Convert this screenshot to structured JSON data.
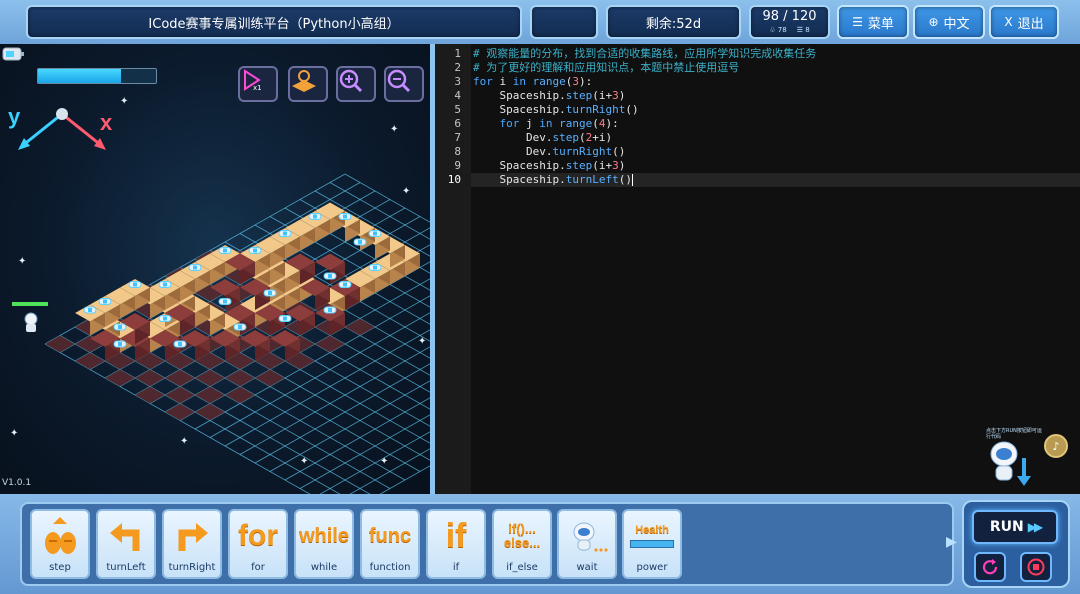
{
  "header": {
    "title": "ICode赛事专属训练平台（Python小高组）",
    "blank": "",
    "remaining": "剩余:52d",
    "score": "98 / 120",
    "stat_a": "78",
    "stat_b": "8",
    "menu_label": "菜单",
    "lang_label": "中文",
    "exit_label": "退出"
  },
  "game": {
    "energy_level": 0.7,
    "axis_y": "y",
    "axis_x": "x",
    "version": "V1.0.1",
    "tools": [
      "play-speed-icon",
      "map-icon",
      "zoom-in-icon",
      "zoom-out-icon"
    ]
  },
  "editor": {
    "lines": [
      {
        "n": "1",
        "text": "# 观察能量的分布，找到合适的收集路线，应用所学知识完成收集任务"
      },
      {
        "n": "2",
        "text": "# 为了更好的理解和应用知识点，本题中禁止使用逗号"
      },
      {
        "n": "3",
        "text": "for i in range(3):"
      },
      {
        "n": "4",
        "text": "    Spaceship.step(i+3)"
      },
      {
        "n": "5",
        "text": "    Spaceship.turnRight()"
      },
      {
        "n": "6",
        "text": "    for j in range(4):"
      },
      {
        "n": "7",
        "text": "        Dev.step(2+i)"
      },
      {
        "n": "8",
        "text": "        Dev.turnRight()"
      },
      {
        "n": "9",
        "text": "    Spaceship.step(i+3)"
      },
      {
        "n": "10",
        "text": "    Spaceship.turnLeft()"
      }
    ],
    "helper_text": "点击下方RUN按钮即可运行代码"
  },
  "blocks": [
    {
      "label": "step",
      "icon": "step-icon"
    },
    {
      "label": "turnLeft",
      "icon": "turn-left-icon"
    },
    {
      "label": "turnRight",
      "icon": "turn-right-icon"
    },
    {
      "label": "for",
      "icon": "for-icon",
      "glyph": "for"
    },
    {
      "label": "while",
      "icon": "while-icon",
      "glyph": "while"
    },
    {
      "label": "function",
      "icon": "function-icon",
      "glyph": "func"
    },
    {
      "label": "if",
      "icon": "if-icon",
      "glyph": "if"
    },
    {
      "label": "if_else",
      "icon": "if-else-icon",
      "glyph": "if()...",
      "glyph2": "else..."
    },
    {
      "label": "wait",
      "icon": "wait-icon"
    },
    {
      "label": "power",
      "icon": "power-icon",
      "glyph": "Health"
    }
  ],
  "run": {
    "label": "RUN"
  },
  "colors": {
    "accent": "#3f97e6",
    "tile_light": "#f2c98a",
    "tile_dark": "#8e3d3d",
    "grid": "#6fd6ff",
    "orange": "#f39a1f"
  }
}
